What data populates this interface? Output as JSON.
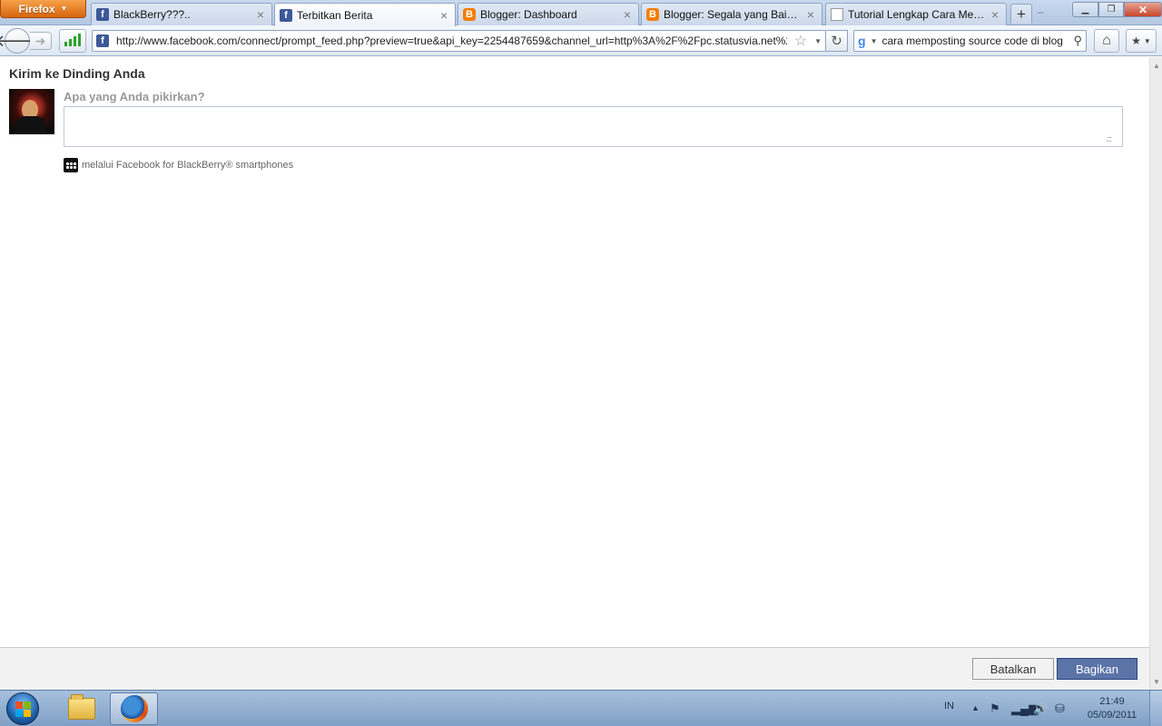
{
  "browser": {
    "menu_button": "Firefox",
    "tabs": [
      {
        "label": "BlackBerry???..",
        "favicon": "facebook-icon"
      },
      {
        "label": "Terbitkan Berita",
        "favicon": "facebook-icon"
      },
      {
        "label": "Blogger: Dashboard",
        "favicon": "blogger-icon"
      },
      {
        "label": "Blogger: Segala yang Baik d...",
        "favicon": "blogger-icon"
      },
      {
        "label": "Tutorial Lengkap Cara Mem...",
        "favicon": "page-icon"
      }
    ],
    "active_tab": 1,
    "url": "http://www.facebook.com/connect/prompt_feed.php?preview=true&api_key=2254487659&channel_url=http%3A%2F%2Fpc.statusvia.net%2",
    "search_value": "cara memposting source code di blog",
    "accent_color": "#3b5998"
  },
  "dialog": {
    "title": "Kirim ke Dinding Anda",
    "prompt": "Apa yang Anda pikirkan?",
    "textarea_value": "",
    "via": "melalui Facebook for BlackBerry® smartphones",
    "cancel_label": "Batalkan",
    "share_label": "Bagikan",
    "share_color": "#5b74a8"
  },
  "taskbar": {
    "language": "IN",
    "time": "21:49",
    "date": "05/09/2011"
  }
}
